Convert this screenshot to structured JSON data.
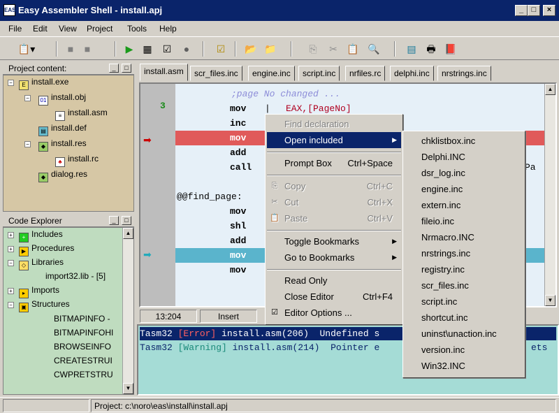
{
  "window": {
    "title": "Easy Assembler Shell - install.apj",
    "minimize": "_",
    "maximize": "□",
    "close": "×"
  },
  "menu": [
    "File",
    "Edit",
    "View",
    "Project",
    "Tools",
    "Help"
  ],
  "project_pane": {
    "title": "Project content:",
    "items": [
      {
        "label": "install.exe",
        "icon": "exe-icon"
      },
      {
        "label": "install.obj",
        "icon": "obj-icon"
      },
      {
        "label": "install.asm",
        "icon": "asm-file-icon"
      },
      {
        "label": "install.def",
        "icon": "def-icon"
      },
      {
        "label": "install.res",
        "icon": "res-icon"
      },
      {
        "label": "install.rc",
        "icon": "rc-icon"
      },
      {
        "label": "dialog.res",
        "icon": "res-icon"
      }
    ]
  },
  "code_explorer": {
    "title": "Code Explorer",
    "items": [
      {
        "label": "Includes",
        "icon": "includes-icon"
      },
      {
        "label": "Procedures",
        "icon": "procedures-icon"
      },
      {
        "label": "Libraries",
        "icon": "libraries-icon"
      },
      {
        "label": "import32.lib - [5]",
        "icon": "lib-item"
      },
      {
        "label": "Imports",
        "icon": "imports-icon"
      },
      {
        "label": "Structures",
        "icon": "structures-icon"
      },
      {
        "label": "BITMAPINFO -",
        "icon": "struct-item"
      },
      {
        "label": "BITMAPINFOHI",
        "icon": "struct-item"
      },
      {
        "label": "BROWSEINFO",
        "icon": "struct-item"
      },
      {
        "label": "CREATESTRUI",
        "icon": "struct-item"
      },
      {
        "label": "CWPRETSTRU",
        "icon": "struct-item"
      }
    ]
  },
  "tabs": [
    "install.asm",
    "scr_files.inc",
    "engine.inc",
    "script.inc",
    "nrfiles.rc",
    "delphi.inc",
    "nrstrings.inc"
  ],
  "editor": {
    "gutter_number": "3",
    "lines": [
      {
        "instr": "",
        "operand": ";page No changed ..."
      },
      {
        "instr": "mov",
        "operand": "EAX,[PageNo]"
      },
      {
        "instr": "inc",
        "operand": ""
      },
      {
        "instr": "mov",
        "operand": ""
      },
      {
        "instr": "add",
        "operand": ""
      },
      {
        "instr": "call",
        "operand": ""
      },
      {
        "instr": "",
        "operand": ""
      },
      {
        "instr": "",
        "operand": ""
      },
      {
        "instr": "mov",
        "operand": ""
      },
      {
        "instr": "shl",
        "operand": ""
      },
      {
        "instr": "add",
        "operand": ""
      },
      {
        "instr": "mov",
        "operand": ""
      },
      {
        "instr": "mov",
        "operand": ""
      }
    ],
    "label_line": "@@find_page:",
    "call_tail": "Pa"
  },
  "edit_status": {
    "position": "13:204",
    "mode": "Insert"
  },
  "messages": [
    {
      "tool": "Tasm32",
      "kind": "[Error]",
      "file": "install.asm(206)",
      "text": "Undefined s"
    },
    {
      "tool": "Tasm32",
      "kind": "[Warning]",
      "file": "install.asm(214)",
      "text": "Pointer e",
      "tail": "ets"
    }
  ],
  "statusbar": {
    "project": "Project: c:\\noro\\eas\\install\\install.apj"
  },
  "context_menu": {
    "items": [
      {
        "label": "Find declaration",
        "shortcut": "",
        "disabled": true
      },
      {
        "label": "Open included",
        "shortcut": "",
        "submenu": true,
        "highlighted": true
      },
      {
        "label": "Prompt Box",
        "shortcut": "Ctrl+Space"
      },
      {
        "label": "Copy",
        "shortcut": "Ctrl+C",
        "disabled": true,
        "icon": "copy-icon"
      },
      {
        "label": "Cut",
        "shortcut": "Ctrl+X",
        "disabled": true,
        "icon": "cut-icon"
      },
      {
        "label": "Paste",
        "shortcut": "Ctrl+V",
        "disabled": true,
        "icon": "paste-icon"
      },
      {
        "label": "Toggle Bookmarks",
        "shortcut": "",
        "submenu": true
      },
      {
        "label": "Go to Bookmarks",
        "shortcut": "",
        "submenu": true
      },
      {
        "label": "Read Only",
        "shortcut": ""
      },
      {
        "label": "Close Editor",
        "shortcut": "Ctrl+F4"
      },
      {
        "label": "Editor Options ...",
        "shortcut": "",
        "icon": "options-icon"
      }
    ]
  },
  "submenu": [
    "chklistbox.inc",
    "Delphi.INC",
    "dsr_log.inc",
    "engine.inc",
    "extern.inc",
    "fileio.inc",
    "Nrmacro.INC",
    "nrstrings.inc",
    "registry.inc",
    "scr_files.inc",
    "script.inc",
    "shortcut.inc",
    "uninst\\unaction.inc",
    "version.inc",
    "Win32.INC"
  ],
  "colors": {
    "title_bg": "#0a246a",
    "project_bg": "#d6c7a5",
    "explorer_bg": "#bfdcbf",
    "editor_bg": "#e6f0f8",
    "error_line": "#e05a5a",
    "exec_line": "#5ab4cc",
    "messages_bg": "#a5dcd6"
  }
}
